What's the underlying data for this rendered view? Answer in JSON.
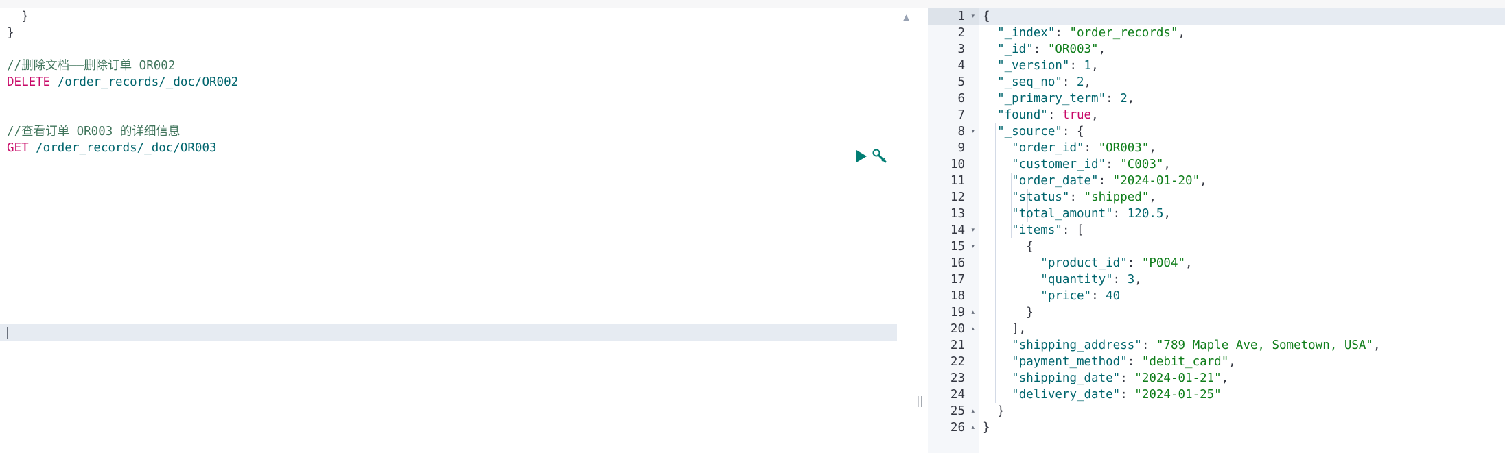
{
  "request_editor": {
    "lines": [
      {
        "type": "plain",
        "text": "  }"
      },
      {
        "type": "plain",
        "text": "}"
      },
      {
        "type": "blank",
        "text": ""
      },
      {
        "type": "comment",
        "text": "//删除文档——删除订单 OR002"
      },
      {
        "type": "request",
        "method": "DELETE",
        "path": " /order_records/_doc/OR002"
      },
      {
        "type": "blank",
        "text": ""
      },
      {
        "type": "blank",
        "text": ""
      },
      {
        "type": "comment",
        "text": "//查看订单 OR003 的详细信息"
      },
      {
        "type": "request",
        "method": "GET",
        "path": " /order_records/_doc/OR003"
      }
    ],
    "icons": [
      "play-icon",
      "wrench-icon"
    ]
  },
  "response": {
    "line_numbers": [
      "1",
      "2",
      "3",
      "4",
      "5",
      "6",
      "7",
      "8",
      "9",
      "10",
      "11",
      "12",
      "13",
      "14",
      "15",
      "16",
      "17",
      "18",
      "19",
      "20",
      "21",
      "22",
      "23",
      "24",
      "25",
      "26"
    ],
    "fold_markers": {
      "1": "▾",
      "8": "▾",
      "14": "▾",
      "15": "▾",
      "19": "▴",
      "20": "▴",
      "25": "▴",
      "26": "▴"
    },
    "lines": [
      [
        [
          "p",
          "{"
        ]
      ],
      [
        [
          "p",
          "  "
        ],
        [
          "k",
          "\"_index\""
        ],
        [
          "p",
          ": "
        ],
        [
          "s",
          "\"order_records\""
        ],
        [
          "p",
          ","
        ]
      ],
      [
        [
          "p",
          "  "
        ],
        [
          "k",
          "\"_id\""
        ],
        [
          "p",
          ": "
        ],
        [
          "s",
          "\"OR003\""
        ],
        [
          "p",
          ","
        ]
      ],
      [
        [
          "p",
          "  "
        ],
        [
          "k",
          "\"_version\""
        ],
        [
          "p",
          ": "
        ],
        [
          "n",
          "1"
        ],
        [
          "p",
          ","
        ]
      ],
      [
        [
          "p",
          "  "
        ],
        [
          "k",
          "\"_seq_no\""
        ],
        [
          "p",
          ": "
        ],
        [
          "n",
          "2"
        ],
        [
          "p",
          ","
        ]
      ],
      [
        [
          "p",
          "  "
        ],
        [
          "k",
          "\"_primary_term\""
        ],
        [
          "p",
          ": "
        ],
        [
          "n",
          "2"
        ],
        [
          "p",
          ","
        ]
      ],
      [
        [
          "p",
          "  "
        ],
        [
          "k",
          "\"found\""
        ],
        [
          "p",
          ": "
        ],
        [
          "b",
          "true"
        ],
        [
          "p",
          ","
        ]
      ],
      [
        [
          "p",
          "  "
        ],
        [
          "k",
          "\"_source\""
        ],
        [
          "p",
          ": {"
        ]
      ],
      [
        [
          "p",
          "    "
        ],
        [
          "k",
          "\"order_id\""
        ],
        [
          "p",
          ": "
        ],
        [
          "s",
          "\"OR003\""
        ],
        [
          "p",
          ","
        ]
      ],
      [
        [
          "p",
          "    "
        ],
        [
          "k",
          "\"customer_id\""
        ],
        [
          "p",
          ": "
        ],
        [
          "s",
          "\"C003\""
        ],
        [
          "p",
          ","
        ]
      ],
      [
        [
          "p",
          "    "
        ],
        [
          "k",
          "\"order_date\""
        ],
        [
          "p",
          ": "
        ],
        [
          "s",
          "\"2024-01-20\""
        ],
        [
          "p",
          ","
        ]
      ],
      [
        [
          "p",
          "    "
        ],
        [
          "k",
          "\"status\""
        ],
        [
          "p",
          ": "
        ],
        [
          "s",
          "\"shipped\""
        ],
        [
          "p",
          ","
        ]
      ],
      [
        [
          "p",
          "    "
        ],
        [
          "k",
          "\"total_amount\""
        ],
        [
          "p",
          ": "
        ],
        [
          "n",
          "120.5"
        ],
        [
          "p",
          ","
        ]
      ],
      [
        [
          "p",
          "    "
        ],
        [
          "k",
          "\"items\""
        ],
        [
          "p",
          ": ["
        ]
      ],
      [
        [
          "p",
          "      {"
        ]
      ],
      [
        [
          "p",
          "        "
        ],
        [
          "k",
          "\"product_id\""
        ],
        [
          "p",
          ": "
        ],
        [
          "s",
          "\"P004\""
        ],
        [
          "p",
          ","
        ]
      ],
      [
        [
          "p",
          "        "
        ],
        [
          "k",
          "\"quantity\""
        ],
        [
          "p",
          ": "
        ],
        [
          "n",
          "3"
        ],
        [
          "p",
          ","
        ]
      ],
      [
        [
          "p",
          "        "
        ],
        [
          "k",
          "\"price\""
        ],
        [
          "p",
          ": "
        ],
        [
          "n",
          "40"
        ]
      ],
      [
        [
          "p",
          "      }"
        ]
      ],
      [
        [
          "p",
          "    ],"
        ]
      ],
      [
        [
          "p",
          "    "
        ],
        [
          "k",
          "\"shipping_address\""
        ],
        [
          "p",
          ": "
        ],
        [
          "s",
          "\"789 Maple Ave, Sometown, USA\""
        ],
        [
          "p",
          ","
        ]
      ],
      [
        [
          "p",
          "    "
        ],
        [
          "k",
          "\"payment_method\""
        ],
        [
          "p",
          ": "
        ],
        [
          "s",
          "\"debit_card\""
        ],
        [
          "p",
          ","
        ]
      ],
      [
        [
          "p",
          "    "
        ],
        [
          "k",
          "\"shipping_date\""
        ],
        [
          "p",
          ": "
        ],
        [
          "s",
          "\"2024-01-21\""
        ],
        [
          "p",
          ","
        ]
      ],
      [
        [
          "p",
          "    "
        ],
        [
          "k",
          "\"delivery_date\""
        ],
        [
          "p",
          ": "
        ],
        [
          "s",
          "\"2024-01-25\""
        ]
      ],
      [
        [
          "p",
          "  }"
        ]
      ],
      [
        [
          "p",
          "}"
        ]
      ]
    ]
  },
  "splitter_glyph": "||",
  "scroll_up_glyph": "▲"
}
